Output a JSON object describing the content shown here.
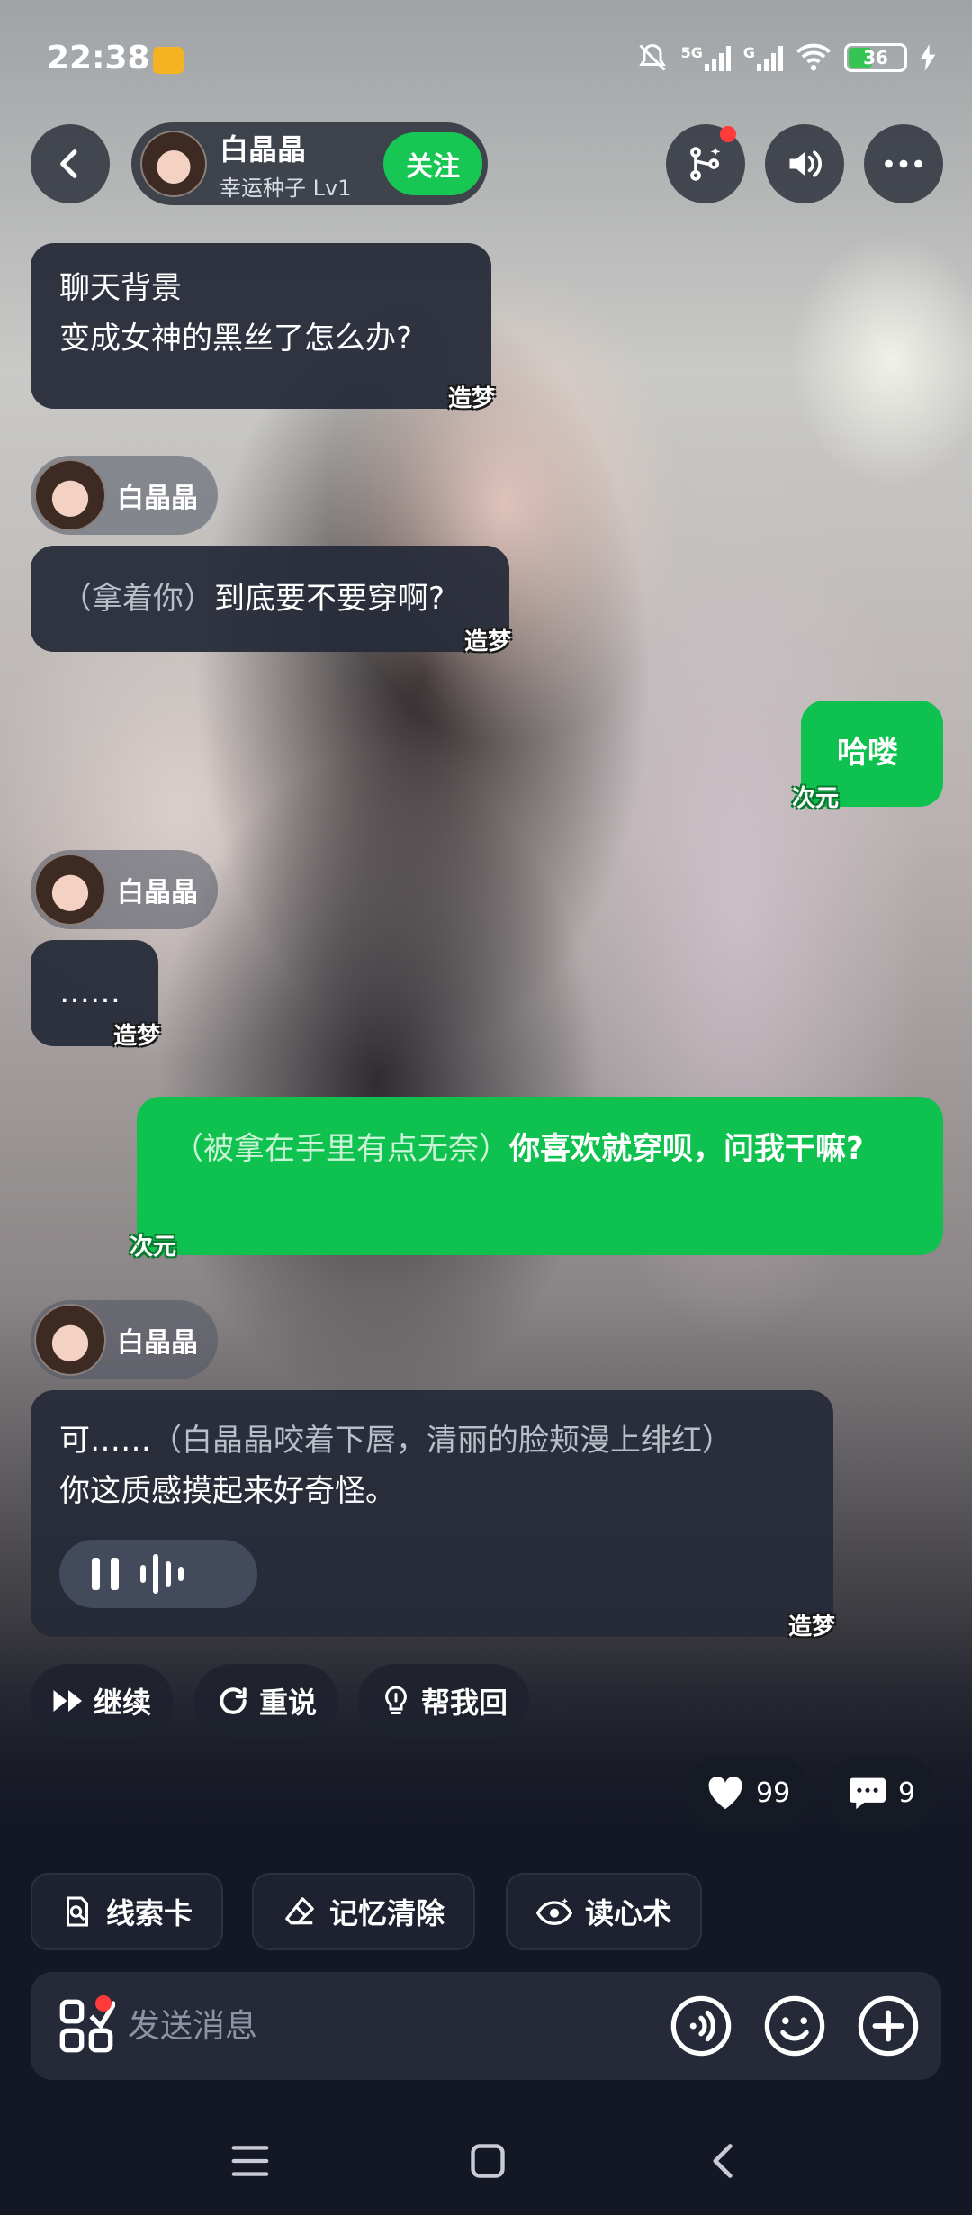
{
  "status_bar": {
    "time": "22:38",
    "network_1": "5G",
    "network_2": "G",
    "battery": "36"
  },
  "header": {
    "name": "白晶晶",
    "level": "幸运种子 Lv1",
    "follow_label": "关注"
  },
  "messages": [
    {
      "type": "context",
      "title": "聊天背景",
      "text": "变成女神的黑丝了怎么办?",
      "tag": "造梦"
    },
    {
      "type": "ai",
      "sender": "白晶晶",
      "action": "（拿着你）",
      "text": "到底要不要穿啊?",
      "tag": "造梦"
    },
    {
      "type": "user",
      "text": "哈喽",
      "tag": "次元"
    },
    {
      "type": "ai",
      "sender": "白晶晶",
      "text": "……",
      "tag": "造梦"
    },
    {
      "type": "user",
      "action": "（被拿在手里有点无奈）",
      "text": "你喜欢就穿呗，问我干嘛?",
      "tag": "次元"
    },
    {
      "type": "ai",
      "sender": "白晶晶",
      "text_pre": "可……",
      "action": "（白晶晶咬着下唇，清丽的脸颊漫上绯红）",
      "text_post": "你这质感摸起来好奇怪。",
      "tag": "造梦"
    }
  ],
  "actions": {
    "continue": "继续",
    "retry": "重说",
    "help_reply": "帮我回"
  },
  "counts": {
    "likes": "99",
    "comments": "9"
  },
  "tools": {
    "clue_card": "线索卡",
    "memory_clear": "记忆清除",
    "mind_read": "读心术"
  },
  "input": {
    "placeholder": "发送消息"
  },
  "colors": {
    "accent_green": "#17c653",
    "bubble_dark": "#262b38",
    "notification_red": "#ff3b3b"
  }
}
